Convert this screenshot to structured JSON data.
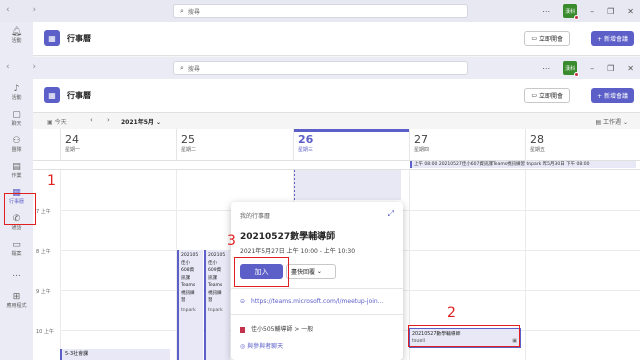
{
  "window": {
    "search_placeholder": "搜尋",
    "avatar_text": "漢科",
    "controls": [
      "⋯",
      "–",
      "❐",
      "✕"
    ]
  },
  "rail": {
    "top_items": [
      {
        "icon": "bell-icon",
        "label": "活動"
      }
    ],
    "items": [
      {
        "icon": "bell-icon",
        "label": "活動"
      },
      {
        "icon": "chat-icon",
        "label": "聊天"
      },
      {
        "icon": "teams-icon",
        "label": "團隊"
      },
      {
        "icon": "assignments-icon",
        "label": "作業"
      },
      {
        "icon": "calendar-icon",
        "label": "行事曆",
        "active": true
      },
      {
        "icon": "phone-icon",
        "label": "通話"
      },
      {
        "icon": "files-icon",
        "label": "檔案"
      },
      {
        "icon": "more-icon",
        "label": "..."
      },
      {
        "icon": "apps-icon",
        "label": "應用程式"
      }
    ]
  },
  "header": {
    "title": "行事曆",
    "meet_now": "立即開會",
    "new_meeting": "+ 新增會議"
  },
  "toolbar": {
    "today": "今天",
    "month": "2021年5月",
    "view": "工作週"
  },
  "days": [
    {
      "num": "24",
      "name": "星期一"
    },
    {
      "num": "25",
      "name": "星期二"
    },
    {
      "num": "26",
      "name": "星期三",
      "today": true
    },
    {
      "num": "27",
      "name": "星期四"
    },
    {
      "num": "28",
      "name": "星期五"
    }
  ],
  "allday_event": "上午 08:00  20210527佳小607資訊課Teams視訊練習  tnpark              昨5月30日 下午 08:00",
  "hours": [
    "7 上午",
    "8 上午",
    "9 上午",
    "10 上午"
  ],
  "events": {
    "tue1": {
      "lines": [
        "202105",
        "佳小",
        "608資",
        "訊課",
        "Teams",
        "視訊練",
        "習"
      ],
      "org": "tnpark"
    },
    "tue2": {
      "lines": [
        "202105",
        "佳小",
        "609資",
        "訊課",
        "Teams",
        "視訊練",
        "習"
      ],
      "org": "tnpark"
    },
    "bottom": "5-3社會課",
    "thu": {
      "title": "20210527數學輔導師",
      "org": "tsueii"
    }
  },
  "popup": {
    "caption": "我的行事曆",
    "title": "20210527數學輔導師",
    "when": "2021年5月27日  上午 10:00 - 上午 10:30",
    "join": "加入",
    "rsvp": "盡快回覆",
    "link": "https://teams.microsoft.com/l/meetup-join...",
    "channel": "佳小505輔導師  >  一般",
    "chat": "與參與者聊天"
  },
  "annotations": [
    "1",
    "2",
    "3"
  ],
  "colors": {
    "accent": "#5b5fc7",
    "annotation": "#e02020"
  }
}
